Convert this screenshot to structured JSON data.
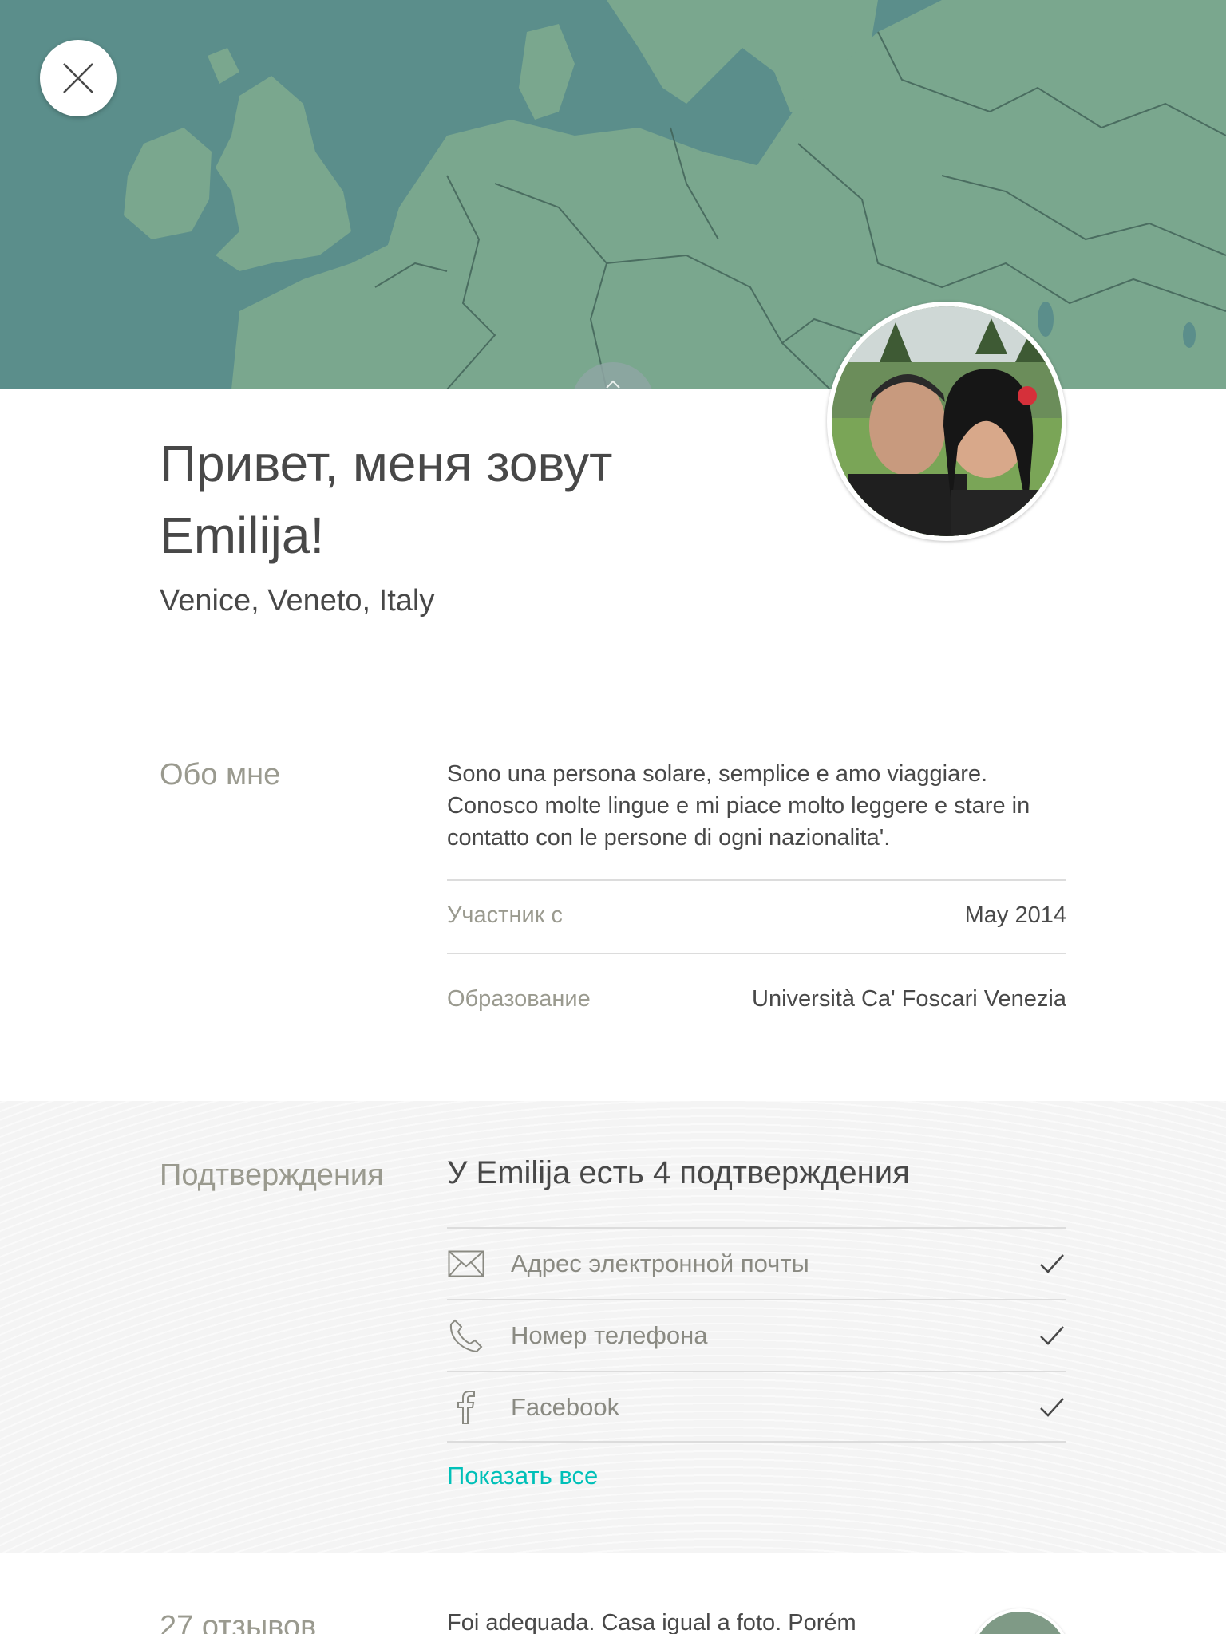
{
  "header": {
    "close_icon": "close-icon",
    "handle_icon": "chevron-up-icon"
  },
  "profile": {
    "greeting": "Привет, меня зовут Emilija!",
    "location": "Venice, Veneto, Italy",
    "avatar": "avatar-photo"
  },
  "about": {
    "label": "Обо мне",
    "text": "Sono una persona solare, semplice e amo viaggiare. Conosco molte lingue e mi piace molto leggere e stare in contatto con le persone di ogni nazionalita'.",
    "member_since_label": "Участник с",
    "member_since_value": "May 2014",
    "education_label": "Образование",
    "education_value": "Università Ca' Foscari Venezia"
  },
  "verifications": {
    "label": "Подтверждения",
    "title": "У Emilija есть 4 подтверждения",
    "items": [
      {
        "label": "Адрес электронной почты",
        "icon": "envelope-icon",
        "verified": true
      },
      {
        "label": "Номер телефона",
        "icon": "phone-icon",
        "verified": true
      },
      {
        "label": "Facebook",
        "icon": "facebook-icon",
        "verified": true
      }
    ],
    "show_all": "Показать все"
  },
  "reviews": {
    "count_label": "27 отзывов",
    "first_review_snippet": "Foi adequada. Casa igual a foto. Porém"
  },
  "colors": {
    "accent": "#00c0b8",
    "text": "#484848",
    "muted": "#9a9a8f",
    "map_water": "#5a8e8a",
    "map_land": "#7da98f"
  }
}
